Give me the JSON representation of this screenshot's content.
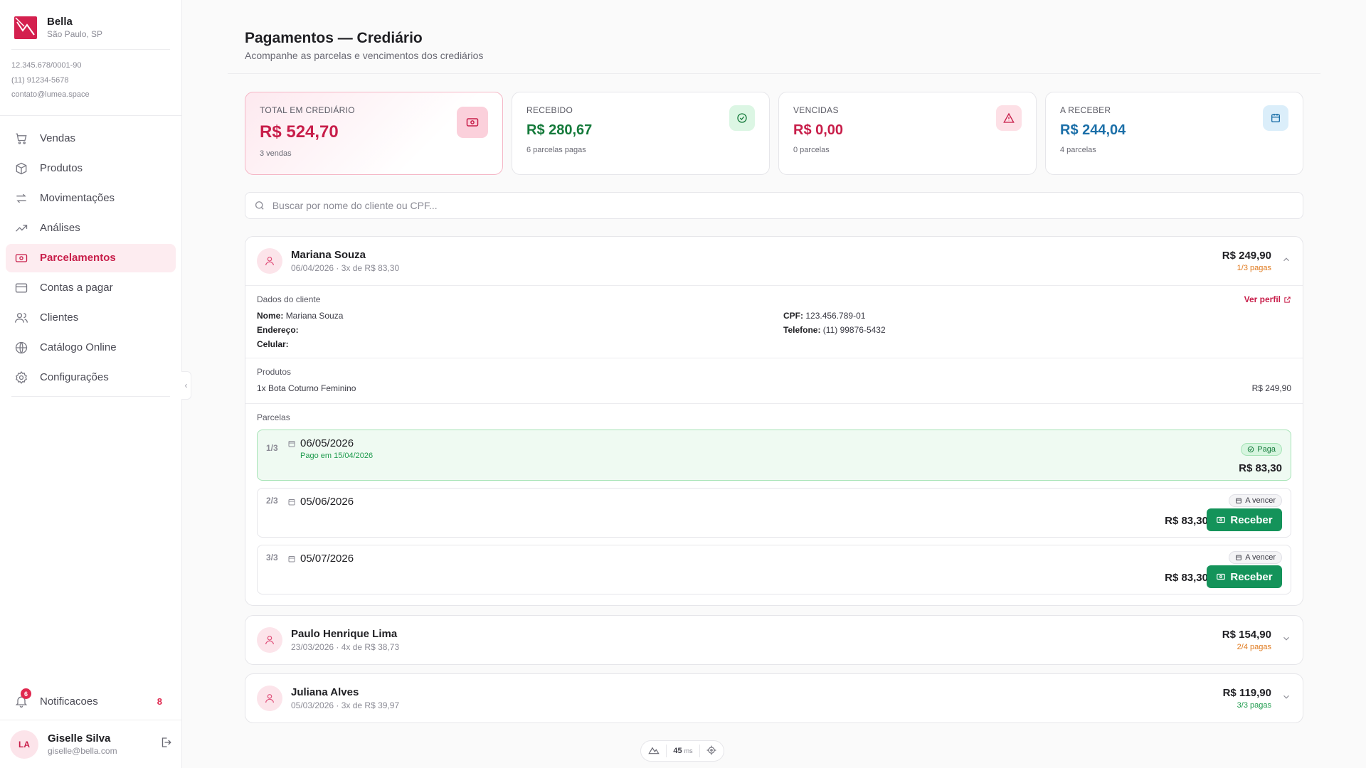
{
  "brand": {
    "name": "Bella",
    "city": "São Paulo, SP",
    "cnpj": "12.345.678/0001-90",
    "phone": "(11) 91234-5678",
    "email": "contato@lumea.space"
  },
  "nav": [
    {
      "label": "Vendas",
      "icon": "cart-icon"
    },
    {
      "label": "Produtos",
      "icon": "box-icon"
    },
    {
      "label": "Movimentações",
      "icon": "arrows-icon"
    },
    {
      "label": "Análises",
      "icon": "trend-icon"
    },
    {
      "label": "Parcelamentos",
      "icon": "banknote-icon",
      "active": true
    },
    {
      "label": "Contas a pagar",
      "icon": "card-icon"
    },
    {
      "label": "Clientes",
      "icon": "users-icon"
    },
    {
      "label": "Catálogo Online",
      "icon": "globe-icon"
    },
    {
      "label": "Configurações",
      "icon": "gear-icon"
    }
  ],
  "notifications": {
    "label": "Notificacoes",
    "badge": "6",
    "count": "8"
  },
  "user": {
    "initials": "LA",
    "name": "Giselle Silva",
    "email": "giselle@bella.com"
  },
  "header": {
    "title": "Pagamentos — Crediário",
    "subtitle": "Acompanhe as parcelas e vencimentos dos crediários"
  },
  "cards": [
    {
      "label": "TOTAL EM CREDIÁRIO",
      "value": "R$ 524,70",
      "sub": "3 vendas",
      "color": "#c81e4a"
    },
    {
      "label": "RECEBIDO",
      "value": "R$ 280,67",
      "sub": "6 parcelas pagas",
      "color": "#157a3b"
    },
    {
      "label": "VENCIDAS",
      "value": "R$ 0,00",
      "sub": "0 parcelas",
      "color": "#c81e4a"
    },
    {
      "label": "A RECEBER",
      "value": "R$ 244,04",
      "sub": "4 parcelas",
      "color": "#1b6fa8"
    }
  ],
  "search": {
    "placeholder": "Buscar por nome do cliente ou CPF..."
  },
  "clients": [
    {
      "name": "Mariana Souza",
      "meta": "06/04/2026 · 3x de R$ 83,30",
      "total": "R$ 249,90",
      "paid": "1/3 pagas",
      "details": {
        "title": "Dados do cliente",
        "link": "Ver perfil",
        "nome_label": "Nome:",
        "nome": "Mariana Souza",
        "endereco_label": "Endereço:",
        "endereco": "",
        "celular_label": "Celular:",
        "celular": "",
        "cpf_label": "CPF:",
        "cpf": "123.456.789-01",
        "telefone_label": "Telefone:",
        "telefone": "(11) 99876-5432"
      },
      "products": {
        "title": "Produtos",
        "item": "1x Bota Coturno Feminino",
        "price": "R$ 249,90"
      },
      "installments_title": "Parcelas",
      "installments": [
        {
          "num": "1/3",
          "date": "06/05/2026",
          "paid_on": "Pago em 15/04/2026",
          "status": "Paga",
          "value": "R$ 83,30"
        },
        {
          "num": "2/3",
          "date": "05/06/2026",
          "status": "A vencer",
          "value": "R$ 83,30",
          "action": "Receber"
        },
        {
          "num": "3/3",
          "date": "05/07/2026",
          "status": "A vencer",
          "value": "R$ 83,30",
          "action": "Receber"
        }
      ]
    },
    {
      "name": "Paulo Henrique Lima",
      "meta": "23/03/2026 · 4x de R$ 38,73",
      "total": "R$ 154,90",
      "paid": "2/4 pagas"
    },
    {
      "name": "Juliana Alves",
      "meta": "05/03/2026 · 3x de R$ 39,97",
      "total": "R$ 119,90",
      "paid": "3/3 pagas"
    }
  ],
  "perf": {
    "value": "45",
    "unit": "ms"
  }
}
